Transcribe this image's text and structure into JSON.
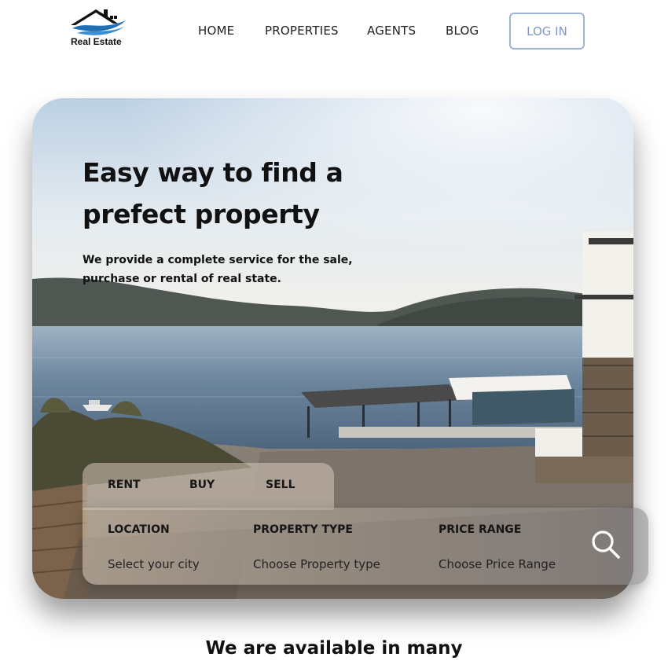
{
  "header": {
    "logo_text": "Real Estate",
    "logo_icon": "house-waves-logo-icon",
    "nav": [
      {
        "label": "HOME"
      },
      {
        "label": "PROPERTIES"
      },
      {
        "label": "AGENTS"
      },
      {
        "label": "BLOG"
      }
    ],
    "login_label": "LOG IN"
  },
  "hero": {
    "title": "Easy way to find a prefect property",
    "subtitle": "We provide a complete service for the sale, purchase or rental of real state.",
    "background": "seaside-villa-photo"
  },
  "search": {
    "tabs": [
      {
        "label": "RENT"
      },
      {
        "label": "BUY"
      },
      {
        "label": "SELL"
      }
    ],
    "fields": [
      {
        "label": "LOCATION",
        "placeholder": "Select your city"
      },
      {
        "label": "PROPERTY TYPE",
        "placeholder": "Choose Property type"
      },
      {
        "label": "PRICE RANGE",
        "placeholder": "Choose Price Range"
      }
    ],
    "search_icon": "search-icon"
  },
  "section": {
    "heading": "We are available in many"
  },
  "colors": {
    "login_border": "#9fb3d6",
    "login_text": "#7f96c7",
    "logo_blue": "#1f6fb5"
  }
}
